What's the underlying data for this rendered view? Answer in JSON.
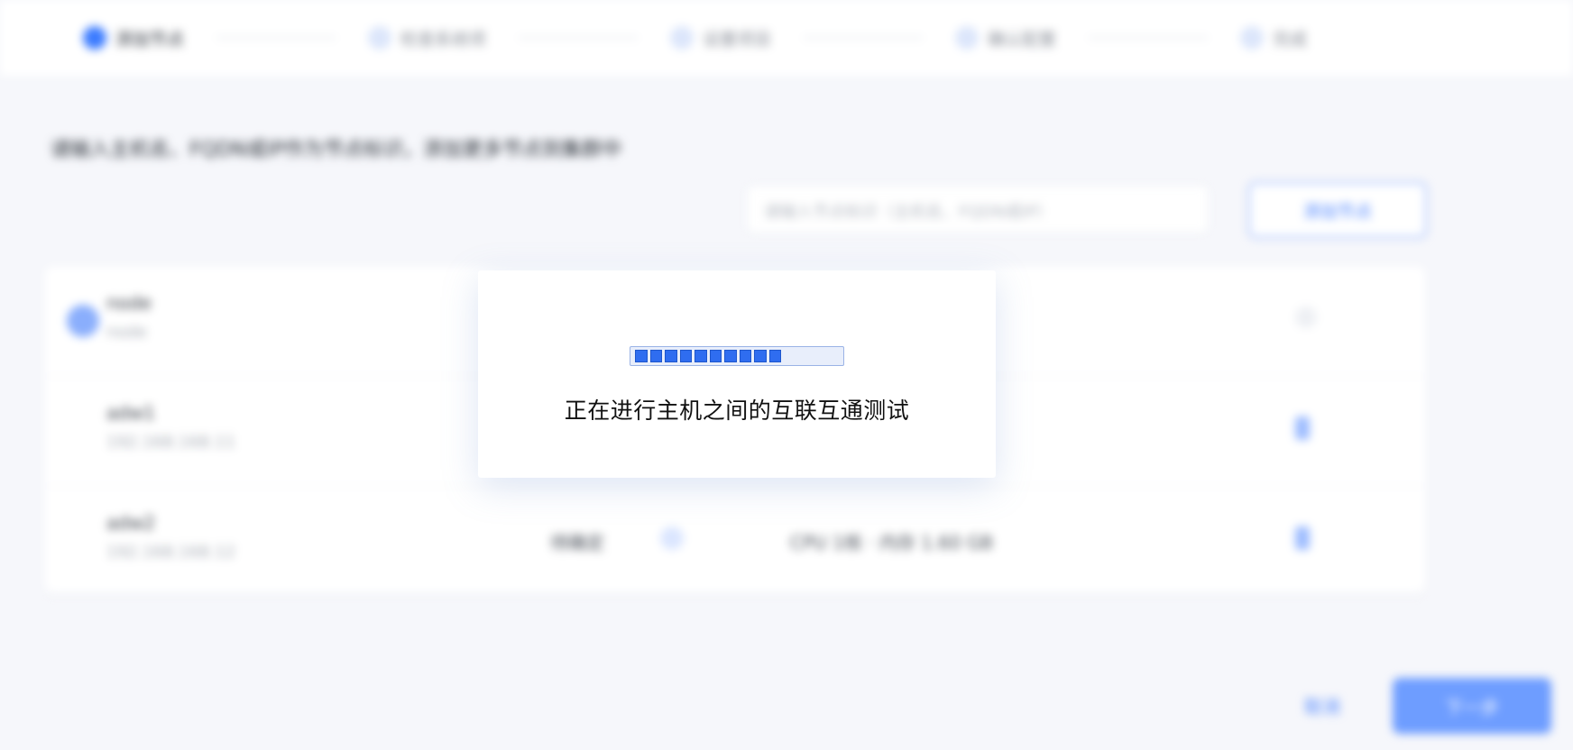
{
  "steps": [
    {
      "label": "添加节点",
      "active": true
    },
    {
      "label": "检查系统项",
      "active": false
    },
    {
      "label": "设置项目",
      "active": false
    },
    {
      "label": "确认配置",
      "active": false
    },
    {
      "label": "完成",
      "active": false
    }
  ],
  "instruction": "请输入主机名、FQDN或IP作为节点标识，添加更多节点到集群中",
  "search": {
    "placeholder": "请输入节点标识（主机名、FQDN或IP）"
  },
  "add_node_button": "添加节点",
  "nodes": [
    {
      "name": "node",
      "sub": "node",
      "status": "",
      "spec": "",
      "selected": true
    },
    {
      "name": "adw1",
      "sub": "192.168.168.11",
      "status": "",
      "spec": "",
      "selected": false
    },
    {
      "name": "adw2",
      "sub": "192.168.168.12",
      "status": "待确定",
      "spec": "CPU 1核 · 内存 1.60 GB",
      "selected": false
    }
  ],
  "footer": {
    "cancel": "取消",
    "next": "下一步"
  },
  "modal": {
    "message": "正在进行主机之间的互联互通测试",
    "progress_segments": 10,
    "progress_fraction": 0.7
  },
  "colors": {
    "accent": "#3b7bff",
    "progress_fill": "#2f6df0",
    "background": "#f6f7fb"
  }
}
